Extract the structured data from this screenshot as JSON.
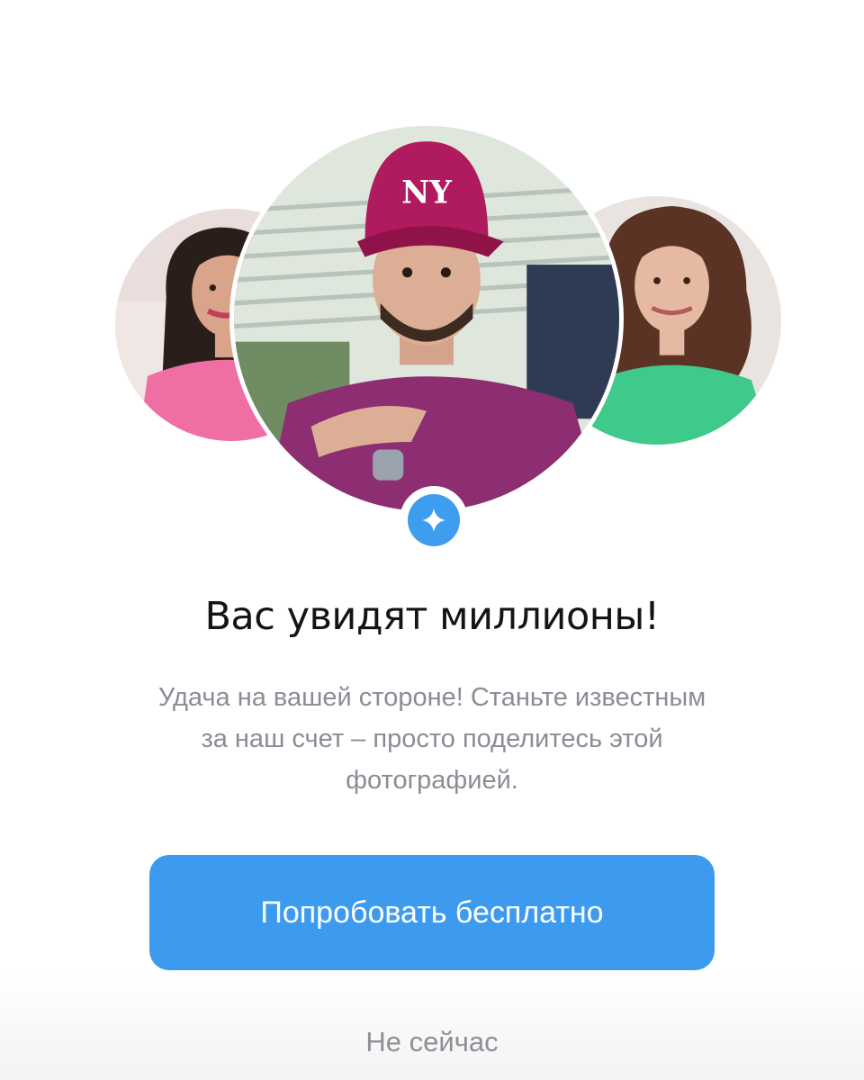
{
  "promo": {
    "title": "Вас увидят миллионы!",
    "subtitle_line1": "Удача на вашей стороне! Станьте известным",
    "subtitle_line2": "за наш счет – просто поделитесь этой",
    "subtitle_line3": "фотографией.",
    "primary_button_label": "Попробовать бесплатно",
    "secondary_link_label": "Не сейчас"
  },
  "avatars": [
    {
      "name": "avatar-left"
    },
    {
      "name": "avatar-main"
    },
    {
      "name": "avatar-right"
    }
  ],
  "badge": {
    "icon": "sparkle-star-icon"
  },
  "colors": {
    "accent": "#3d9bef",
    "title_text": "#141414",
    "body_text": "#8c8c96",
    "background": "#ffffff"
  }
}
